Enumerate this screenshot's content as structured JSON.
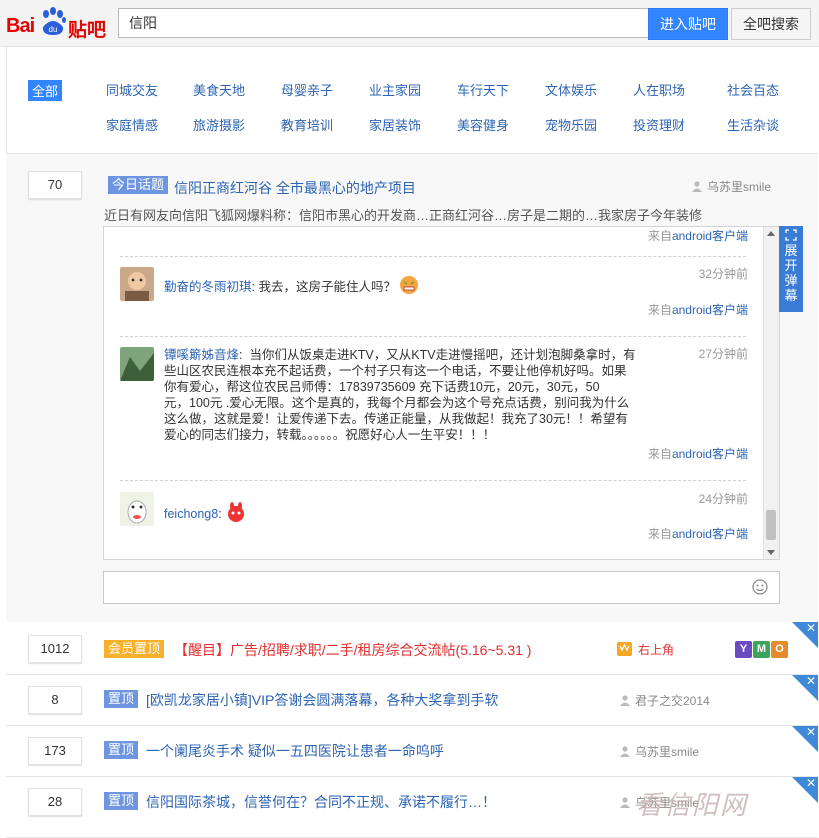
{
  "header": {
    "logo_bai": "Bai",
    "logo_du": "du",
    "logo_tieba": "贴吧",
    "search_value": "信阳",
    "enter_button": "进入贴吧",
    "search_all_button": "全吧搜索"
  },
  "categories": {
    "row1": [
      "全部",
      "同城交友",
      "美食天地",
      "母婴亲子",
      "业主家园",
      "车行天下",
      "文体娱乐",
      "人在职场",
      "社会百态"
    ],
    "row2": [
      "家庭情感",
      "旅游摄影",
      "教育培训",
      "家居装饰",
      "美容健身",
      "宠物乐园",
      "投资理财",
      "生活杂谈"
    ]
  },
  "thread_expanded": {
    "reply_count": "70",
    "tag": "今日话题",
    "title": "信阳正商红河谷 全市最黑心的地产项目",
    "author": "乌苏里smile",
    "excerpt": "近日有网友向信阳飞狐网爆料称：信阳市黑心的开发商…正商红河谷…房子是二期的…我家房子今年装修",
    "danmu_button": "展开弹幕",
    "replies": [
      {
        "source_prefix": "来自",
        "source_link": "android客户端"
      },
      {
        "name": "勤奋的冬雨初琪",
        "colon": ":",
        "text": "我去，这房子能住人吗？",
        "time": "32分钟前",
        "source_prefix": "来自",
        "source_link": "android客户端"
      },
      {
        "name": "镡嗘簛姊音烽",
        "colon": ":",
        "text_lines": [
          "当你们从饭桌走进KTV，又从KTV走进慢摇吧，还计划泡脚桑拿时，有",
          "些山区农民连根本充不起话费，一个村子只有这一个电话，不要让他停机好吗。如果",
          "你有爱心，帮这位农民吕师傅：17839735609 充下话费10元，20元，30元，50",
          "元，100元 .爱心无限。这个是真的，我每个月都会为这个号充点话费，别问我为什么",
          "这么做，这就是爱！让爱传递下去。传递正能量，从我做起！我充了30元！！希望有",
          "爱心的同志们接力，转载。。。。。。祝愿好心人一生平安！！！"
        ],
        "time": "27分钟前",
        "source_prefix": "来自",
        "source_link": "android客户端"
      },
      {
        "name": "feichong8",
        "colon": ":",
        "time": "24分钟前",
        "source_prefix": "来自",
        "source_link": "android客户端"
      }
    ]
  },
  "threads": [
    {
      "reply_count": "1012",
      "tag": "会员置顶",
      "title": "【醒目】广告/招聘/求职/二手/租房综合交流帖(5.16~5.31 )",
      "author": "右上角",
      "close": "✕"
    },
    {
      "reply_count": "8",
      "tag": "置顶",
      "title": "[欧凯龙家居小镇]VIP答谢会圆满落幕，各种大奖拿到手软",
      "author": "君子之交2014",
      "close": "✕"
    },
    {
      "reply_count": "173",
      "tag": "置顶",
      "title": "一个阑尾炎手术 疑似一五四医院让患者一命呜呼",
      "author": "乌苏里smile",
      "close": "✕"
    },
    {
      "reply_count": "28",
      "tag": "置顶",
      "title": "信阳国际茶城，信誉何在？合同不正规、承诺不履行…！",
      "author": "乌苏里smile",
      "close": "✕"
    }
  ],
  "badges": [
    "Y",
    "M",
    "O"
  ],
  "watermark": "看信阳网",
  "colors": {
    "link_blue": "#2d64b3",
    "accent_blue": "#3385ff",
    "tag_blue": "#6e96e0",
    "vip_orange": "#f9b02a",
    "alert_red": "#e12e2e"
  }
}
